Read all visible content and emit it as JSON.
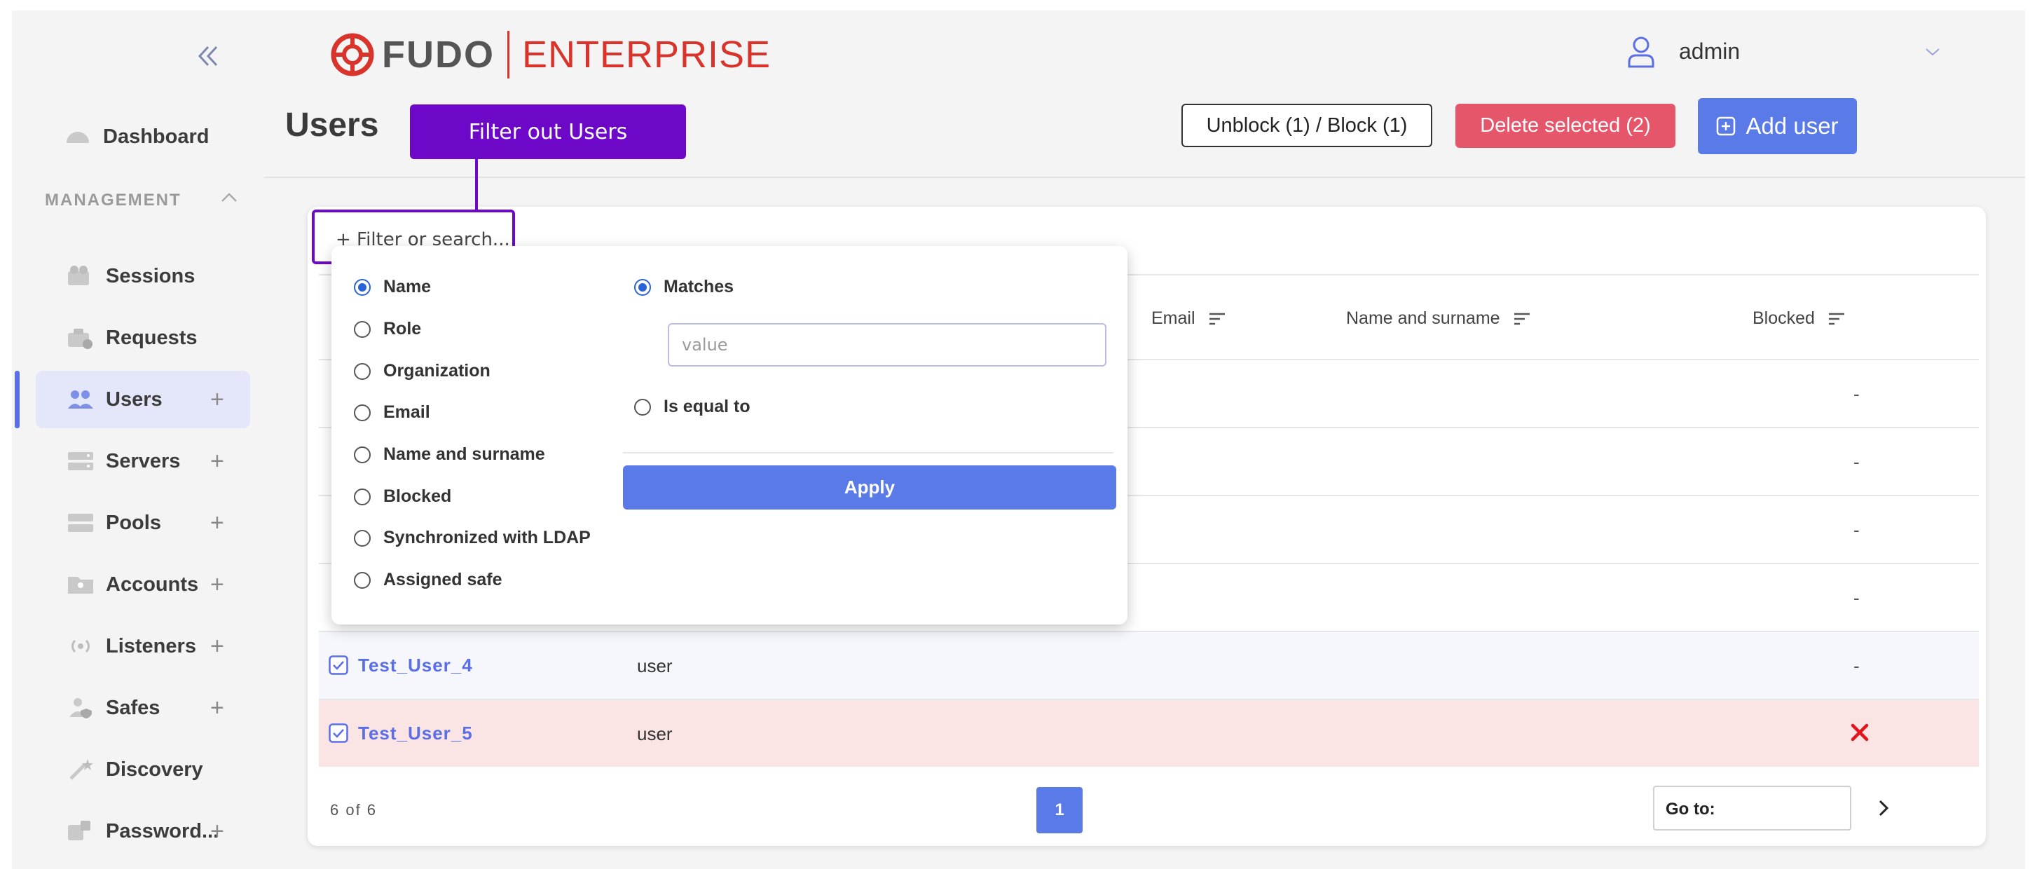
{
  "sidebar": {
    "items": [
      {
        "label": "Dashboard",
        "icon": "dashboard-icon"
      },
      {
        "label": "Sessions",
        "icon": "sessions-icon"
      },
      {
        "label": "Requests",
        "icon": "requests-icon"
      },
      {
        "label": "Users",
        "icon": "users-icon",
        "plus": "+"
      },
      {
        "label": "Servers",
        "icon": "servers-icon",
        "plus": "+"
      },
      {
        "label": "Pools",
        "icon": "pools-icon",
        "plus": "+"
      },
      {
        "label": "Accounts",
        "icon": "accounts-icon",
        "plus": "+"
      },
      {
        "label": "Listeners",
        "icon": "listeners-icon",
        "plus": "+"
      },
      {
        "label": "Safes",
        "icon": "safes-icon",
        "plus": "+"
      },
      {
        "label": "Discovery",
        "icon": "discovery-icon"
      },
      {
        "label": "Password...",
        "icon": "password-icon",
        "plus": "+"
      }
    ],
    "section_label": "MANAGEMENT",
    "active": "Users"
  },
  "header": {
    "logo_primary": "FUDO",
    "logo_secondary": "ENTERPRISE",
    "user_name": "admin",
    "page_title": "Users",
    "unblock_label": "Unblock (1) / Block (1)",
    "delete_label": "Delete selected (2)",
    "add_label": "Add user"
  },
  "callout": {
    "text": "Filter out Users"
  },
  "filter": {
    "placeholder": "+ Filter or search..."
  },
  "table": {
    "columns": {
      "email": "Email",
      "name_surname": "Name and surname",
      "blocked": "Blocked"
    },
    "rows": [
      {
        "name": "",
        "role": "",
        "blocked": "-"
      },
      {
        "name": "",
        "role": "",
        "blocked": "-"
      },
      {
        "name": "",
        "role": "",
        "blocked": "-"
      },
      {
        "name": "",
        "role": "",
        "blocked": "-"
      },
      {
        "name": "Test_User_4",
        "role": "user",
        "blocked": "-",
        "checked": true
      },
      {
        "name": "Test_User_5",
        "role": "user",
        "blocked": "x",
        "checked": true
      }
    ],
    "count": "6 of 6",
    "page": "1",
    "goto_label": "Go to:"
  },
  "dropdown": {
    "fields": [
      "Name",
      "Role",
      "Organization",
      "Email",
      "Name and surname",
      "Blocked",
      "Synchronized with LDAP",
      "Assigned safe"
    ],
    "selected_field": "Name",
    "matches_label": "Matches",
    "value_placeholder": "value",
    "equal_label": "Is equal to",
    "apply_label": "Apply"
  },
  "colors": {
    "accent": "#5a7ae8",
    "danger": "#e6566a",
    "callout": "#6d08c9",
    "brand_red": "#d9342b"
  }
}
